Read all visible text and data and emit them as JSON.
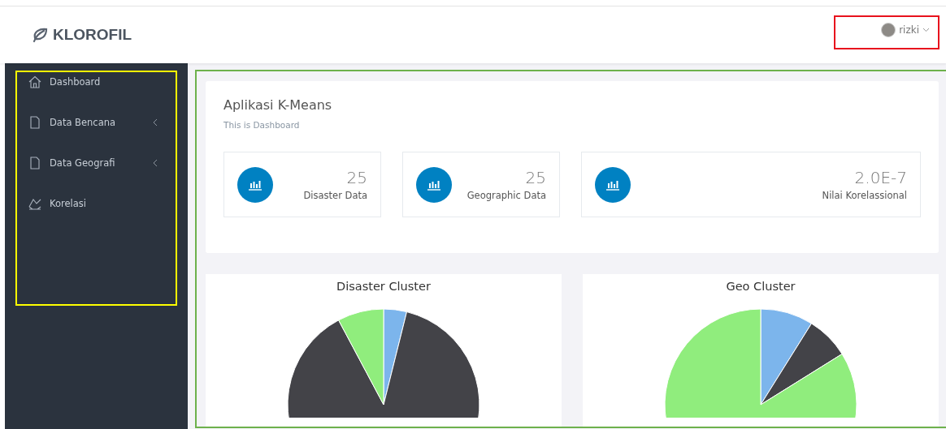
{
  "brand": {
    "name": "KLOROFIL"
  },
  "user": {
    "name": "rizki"
  },
  "sidebar": {
    "items": [
      {
        "label": "Dashboard",
        "kind": "home",
        "has_submenu": false
      },
      {
        "label": "Data Bencana",
        "kind": "file",
        "has_submenu": true
      },
      {
        "label": "Data Geografi",
        "kind": "file",
        "has_submenu": true
      },
      {
        "label": "Korelasi",
        "kind": "chart",
        "has_submenu": false
      }
    ]
  },
  "panel": {
    "title": "Aplikasi K-Means",
    "subtitle": "This is Dashboard",
    "stats": [
      {
        "value": "25",
        "label": "Disaster Data"
      },
      {
        "value": "25",
        "label": "Geographic Data"
      },
      {
        "value": "2.0E-7",
        "label": "Nilai Korelassional"
      }
    ]
  },
  "charts": [
    {
      "title": "Disaster Cluster",
      "kind": "disaster"
    },
    {
      "title": "Geo Cluster",
      "kind": "geo"
    }
  ]
}
